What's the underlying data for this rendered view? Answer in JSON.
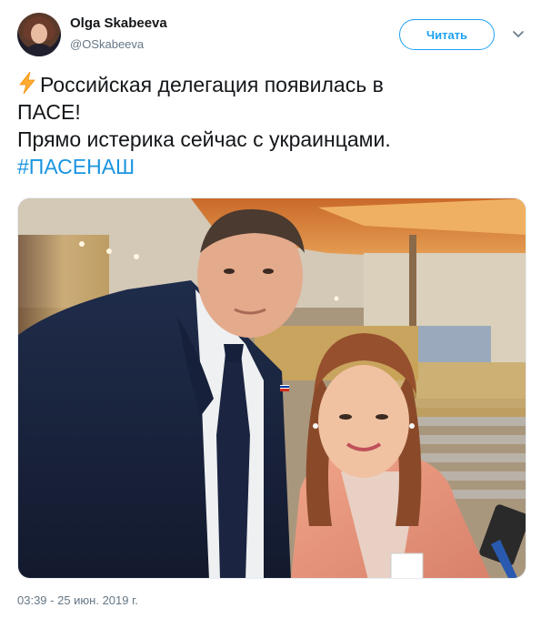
{
  "author": {
    "name": "Olga Skabeeva",
    "handle": "@OSkabeeva"
  },
  "follow_button": {
    "label": "Читать"
  },
  "menu": {
    "icon": "chevron-down-icon"
  },
  "tweet": {
    "emoji": "lightning-icon",
    "line1": "Российская делегация появилась в",
    "line2": "ПАСЕ!",
    "line3": "Прямо истерика сейчас с украинцами.",
    "hashtag": "#ПАСЕНАШ"
  },
  "timestamp": "03:39 - 25 июн. 2019 г.",
  "colors": {
    "accent": "#1da1f2",
    "hashtag": "#1b95e0",
    "secondary_text": "#657786"
  }
}
